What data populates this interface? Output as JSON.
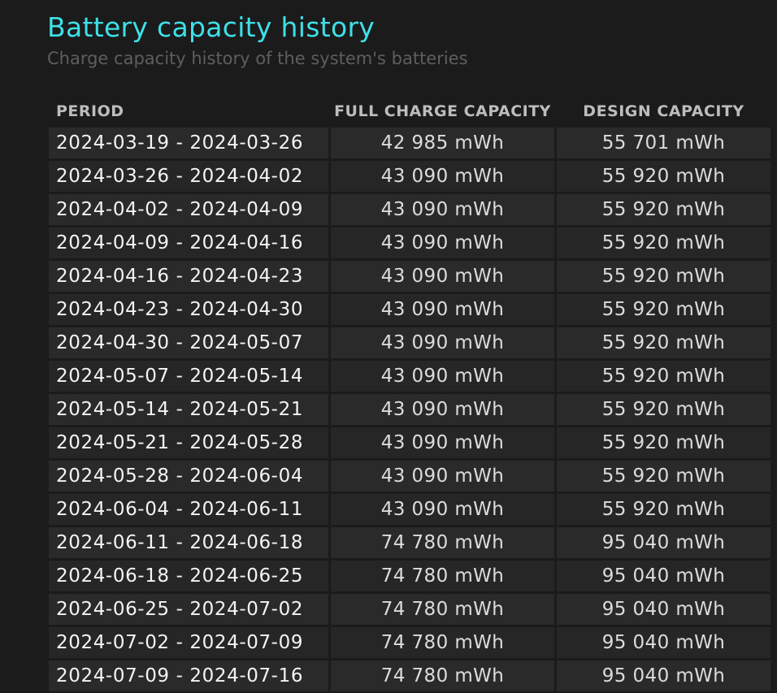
{
  "header": {
    "title": "Battery capacity history",
    "subtitle": "Charge capacity history of the system's batteries"
  },
  "table": {
    "columns": [
      "PERIOD",
      "FULL CHARGE CAPACITY",
      "DESIGN CAPACITY"
    ],
    "rows": [
      {
        "period": "2024-03-19 - 2024-03-26",
        "full": "42 985 mWh",
        "design": "55 701 mWh"
      },
      {
        "period": "2024-03-26 - 2024-04-02",
        "full": "43 090 mWh",
        "design": "55 920 mWh"
      },
      {
        "period": "2024-04-02 - 2024-04-09",
        "full": "43 090 mWh",
        "design": "55 920 mWh"
      },
      {
        "period": "2024-04-09 - 2024-04-16",
        "full": "43 090 mWh",
        "design": "55 920 mWh"
      },
      {
        "period": "2024-04-16 - 2024-04-23",
        "full": "43 090 mWh",
        "design": "55 920 mWh"
      },
      {
        "period": "2024-04-23 - 2024-04-30",
        "full": "43 090 mWh",
        "design": "55 920 mWh"
      },
      {
        "period": "2024-04-30 - 2024-05-07",
        "full": "43 090 mWh",
        "design": "55 920 mWh"
      },
      {
        "period": "2024-05-07 - 2024-05-14",
        "full": "43 090 mWh",
        "design": "55 920 mWh"
      },
      {
        "period": "2024-05-14 - 2024-05-21",
        "full": "43 090 mWh",
        "design": "55 920 mWh"
      },
      {
        "period": "2024-05-21 - 2024-05-28",
        "full": "43 090 mWh",
        "design": "55 920 mWh"
      },
      {
        "period": "2024-05-28 - 2024-06-04",
        "full": "43 090 mWh",
        "design": "55 920 mWh"
      },
      {
        "period": "2024-06-04 - 2024-06-11",
        "full": "43 090 mWh",
        "design": "55 920 mWh"
      },
      {
        "period": "2024-06-11 - 2024-06-18",
        "full": "74 780 mWh",
        "design": "95 040 mWh"
      },
      {
        "period": "2024-06-18 - 2024-06-25",
        "full": "74 780 mWh",
        "design": "95 040 mWh"
      },
      {
        "period": "2024-06-25 - 2024-07-02",
        "full": "74 780 mWh",
        "design": "95 040 mWh"
      },
      {
        "period": "2024-07-02 - 2024-07-09",
        "full": "74 780 mWh",
        "design": "95 040 mWh"
      },
      {
        "period": "2024-07-09 - 2024-07-16",
        "full": "74 780 mWh",
        "design": "95 040 mWh"
      }
    ]
  },
  "colors": {
    "background": "#1b1b1b",
    "title": "#3ee0e8",
    "subtitle": "#5e5e5e",
    "cell": "#2a2a2a"
  }
}
